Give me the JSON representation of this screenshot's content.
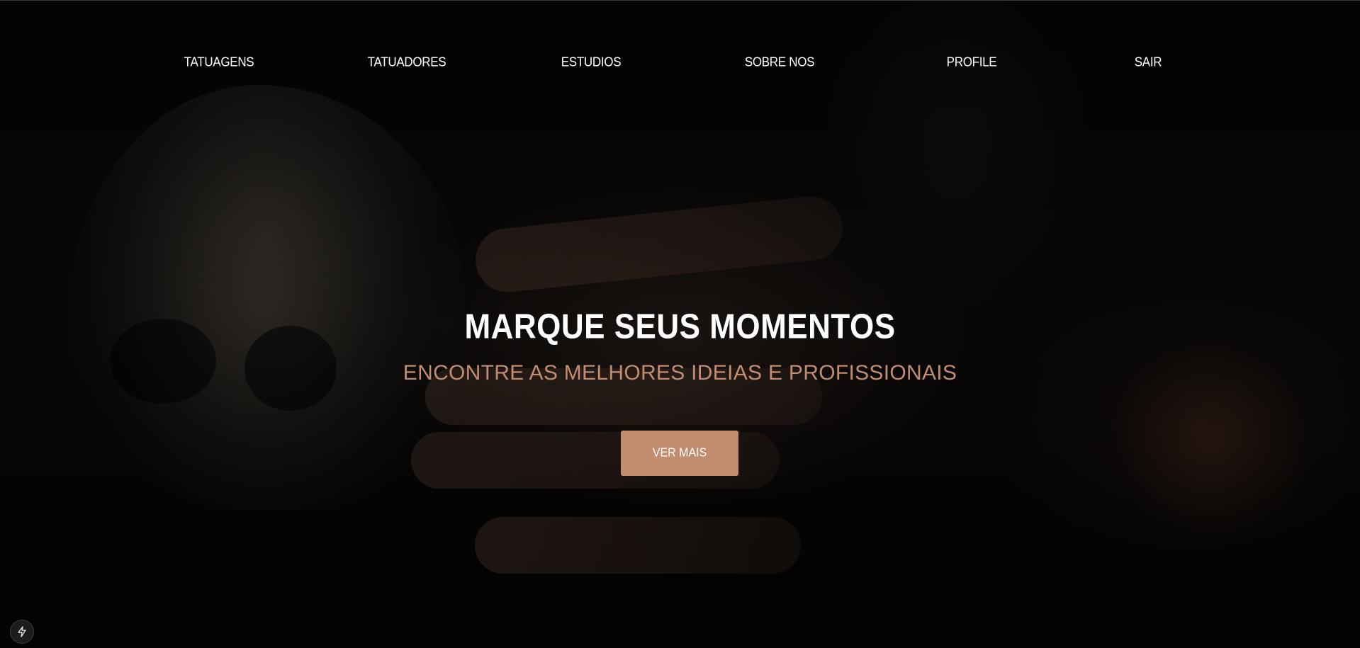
{
  "nav": {
    "items": [
      {
        "label": "TATUAGENS"
      },
      {
        "label": "TATUADORES"
      },
      {
        "label": "ESTUDIOS"
      },
      {
        "label": "SOBRE NOS"
      },
      {
        "label": "PROFILE"
      },
      {
        "label": "SAIR"
      }
    ]
  },
  "hero": {
    "title": "MARQUE SEUS MOMENTOS",
    "subtitle": "ENCONTRE AS MELHORES IDEIAS E PROFISSIONAIS",
    "cta_label": "VER MAIS",
    "background_image": "dark-tattooed-hands-and-skull-photo"
  },
  "dev_badge": {
    "icon": "lightning-bolt-icon"
  },
  "colors": {
    "accent": "#c28c6e",
    "background": "#050505",
    "text": "#ffffff"
  }
}
